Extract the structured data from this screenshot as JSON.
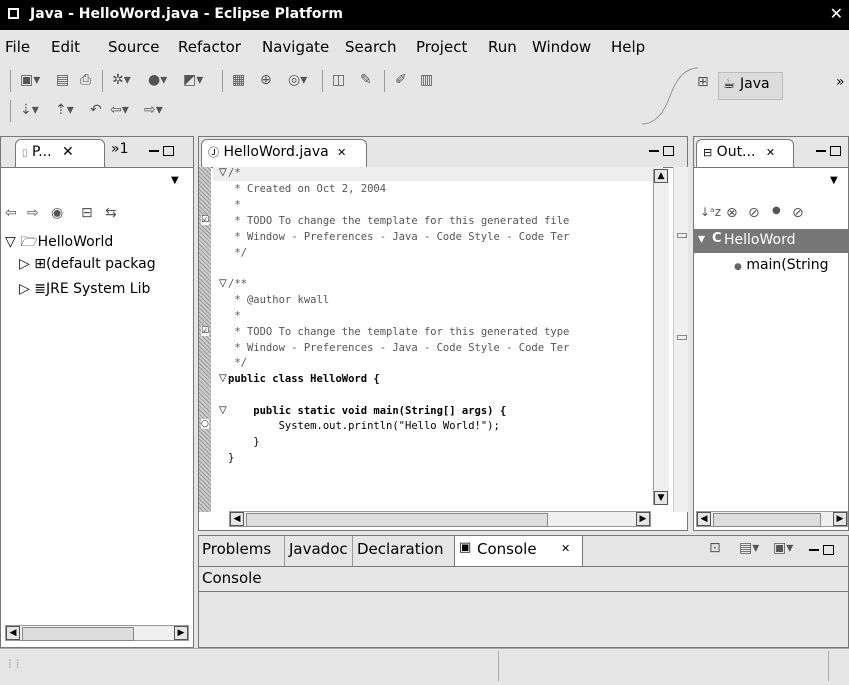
{
  "window": {
    "title": "Java - HelloWord.java - Eclipse Platform",
    "close_glyph": "✕"
  },
  "menu": [
    "File",
    "Edit",
    "Source",
    "Refactor",
    "Navigate",
    "Search",
    "Project",
    "Run",
    "Window",
    "Help"
  ],
  "perspective": {
    "label": "Java"
  },
  "package_explorer": {
    "tab_label": "P...",
    "overflow_label": "»1",
    "tree": {
      "project": "HelloWorld",
      "children": [
        "(default packag",
        "JRE System Lib"
      ]
    }
  },
  "editor": {
    "tab_label": "HelloWord.java",
    "code": [
      "/*",
      " * Created on Oct 2, 2004",
      " *",
      " * TODO To change the template for this generated file",
      " * Window - Preferences - Java - Code Style - Code Ter",
      " */",
      "",
      "/**",
      " * @author kwall",
      " *",
      " * TODO To change the template for this generated type",
      " * Window - Preferences - Java - Code Style - Code Ter",
      " */",
      "public class HelloWord {",
      "",
      "    public static void main(String[] args) {",
      "        System.out.println(\"Hello World!\");",
      "    }",
      "}"
    ]
  },
  "outline": {
    "tab_label": "Out...",
    "class_node": "HelloWord",
    "method_node": "main(String"
  },
  "bottom_panel": {
    "tabs": [
      "Problems",
      "Javadoc",
      "Declaration",
      "Console"
    ],
    "active_tab": "Console",
    "content_title": "Console"
  }
}
